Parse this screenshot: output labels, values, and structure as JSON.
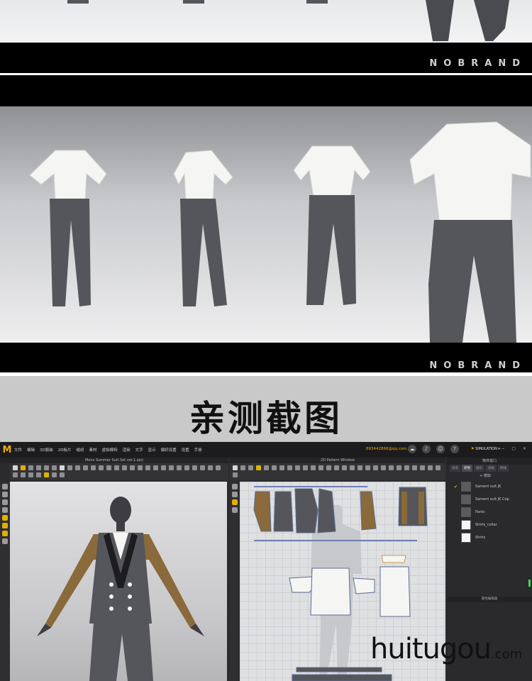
{
  "brand": {
    "name": "NOBRAND"
  },
  "section": {
    "title": "亲测截图"
  },
  "app": {
    "logo": "M",
    "menu": [
      "文件",
      "编辑",
      "3D服装",
      "2D板片",
      "缝纫",
      "素材",
      "虚拟模特",
      "渲染",
      "文字",
      "显示",
      "偏好设置",
      "设置",
      "手册"
    ],
    "account_email": "893442868@qq.com",
    "mode_label": "SIMULATION",
    "window_3d_title": "Mens Summer Suit Set ver.1.zprj",
    "window_2d_title": "2D Pattern Window",
    "object_panel": {
      "title": "物体窗口",
      "tabs": [
        "场景",
        "织物",
        "纽扣",
        "扣眼",
        "明线"
      ],
      "add_label": "+ 增加",
      "items": [
        {
          "label": "Sament suit JK",
          "color": "#5b5b60",
          "checked": true
        },
        {
          "label": "Sament suit JK Cop",
          "color": "#5b5b60",
          "checked": false
        },
        {
          "label": "Pants",
          "color": "#5b5b60",
          "checked": false
        },
        {
          "label": "Shirts_collar",
          "color": "#f5f5f5",
          "checked": false
        },
        {
          "label": "Shirts",
          "color": "#f5f5f5",
          "checked": false
        }
      ],
      "properties_title": "属性编辑器"
    }
  },
  "watermark": {
    "main": "huitugou",
    "suffix": ".com"
  },
  "colors": {
    "accent": "#f2a900",
    "suit": "#55565b",
    "sleeve": "#8a6a3b",
    "shirt": "#f5f5f3"
  }
}
